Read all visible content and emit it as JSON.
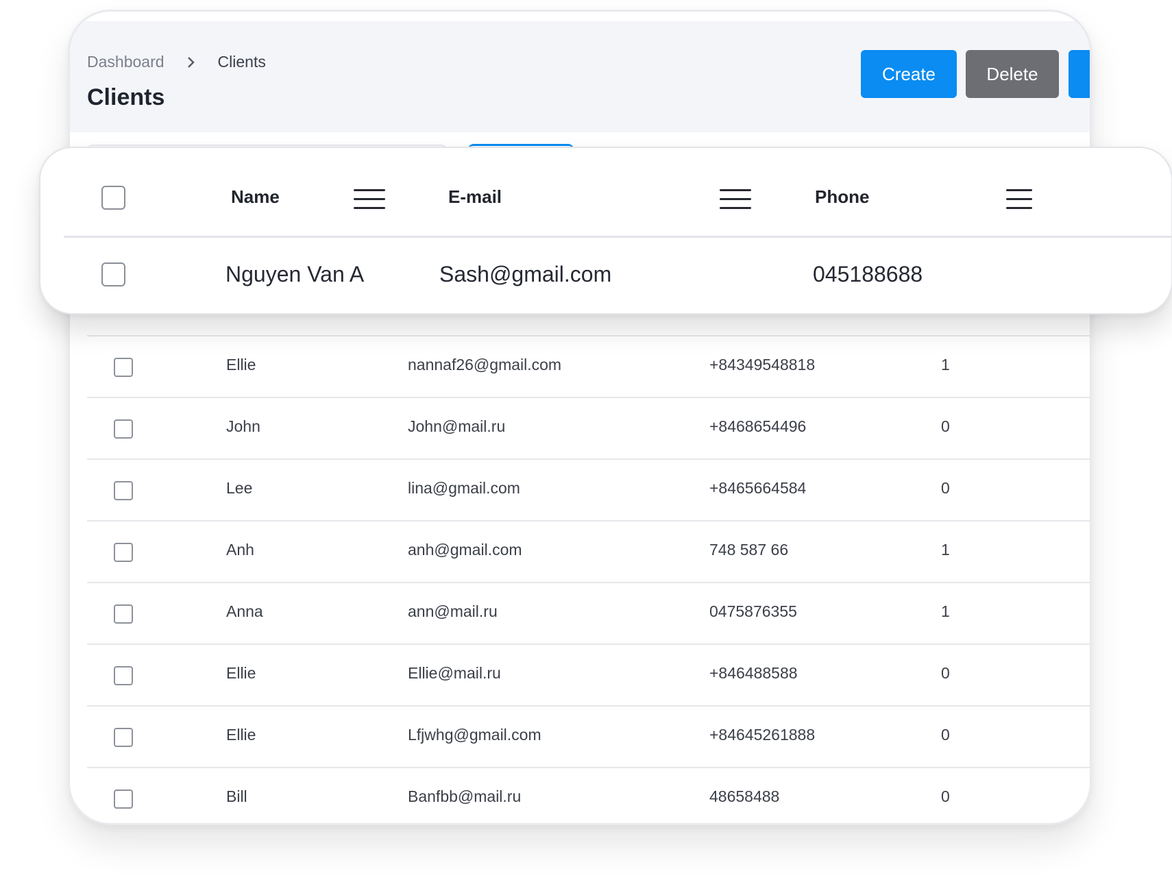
{
  "breadcrumb": {
    "parent": "Dashboard",
    "current": "Clients"
  },
  "page_title": "Clients",
  "actions": {
    "create_label": "Create",
    "delete_label": "Delete"
  },
  "icons": {
    "separator": "chevron-right-icon",
    "column_menu": "menu-icon",
    "checkbox": "checkbox-icon"
  },
  "colors": {
    "primary": "#0a8cf2",
    "secondary": "#6c6e74",
    "header_bg": "#f4f5f8"
  },
  "popout": {
    "columns": [
      "Name",
      "E-mail",
      "Phone"
    ],
    "row": {
      "name": "Nguyen Van A",
      "email": "Sash@gmail.com",
      "phone": "045188688"
    }
  },
  "clients": [
    {
      "name": "Ellie",
      "email": "nannaf26@gmail.com",
      "phone": "+84349548818",
      "count": "1"
    },
    {
      "name": "John",
      "email": "John@mail.ru",
      "phone": "+8468654496",
      "count": "0"
    },
    {
      "name": "Lee",
      "email": "lina@gmail.com",
      "phone": "+8465664584",
      "count": "0"
    },
    {
      "name": "Anh",
      "email": "anh@gmail.com",
      "phone": "748 587 66",
      "count": "1"
    },
    {
      "name": "Anna",
      "email": "ann@mail.ru",
      "phone": "0475876355",
      "count": "1"
    },
    {
      "name": "Ellie",
      "email": "Ellie@mail.ru",
      "phone": "+846488588",
      "count": "0"
    },
    {
      "name": "Ellie",
      "email": "Lfjwhg@gmail.com",
      "phone": "+84645261888",
      "count": "0"
    },
    {
      "name": "Bill",
      "email": "Banfbb@mail.ru",
      "phone": "48658488",
      "count": "0"
    }
  ]
}
